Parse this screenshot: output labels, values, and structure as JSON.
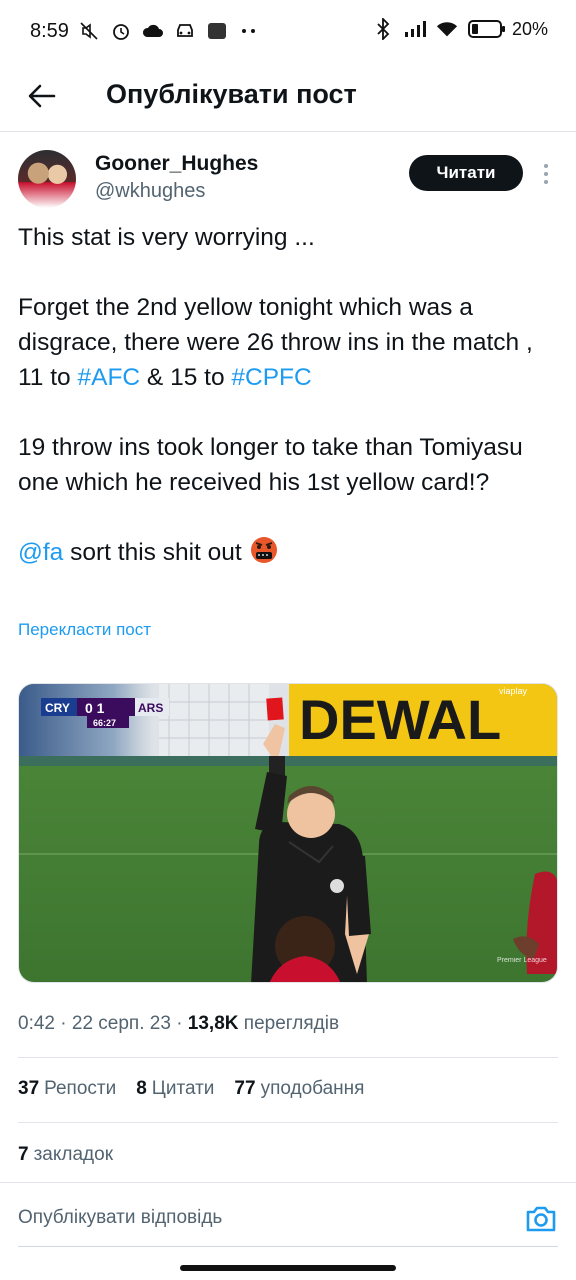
{
  "status_bar": {
    "time": "8:59",
    "battery": "20%",
    "icons": [
      "mute-icon",
      "alarm-icon",
      "cloud-icon",
      "car-icon",
      "app-icon",
      "more-dots-icon",
      "bluetooth-icon",
      "signal-icon",
      "wifi-icon",
      "battery-icon"
    ]
  },
  "header": {
    "title": "Опублікувати пост"
  },
  "author": {
    "name": "Gooner_Hughes",
    "handle": "@wkhughes",
    "follow_label": "Читати"
  },
  "tweet": {
    "line1": "This stat is very worrying ...",
    "para2_a": "Forget the 2nd yellow tonight which was a disgrace, there were 26 throw ins in the match , 11 to ",
    "hashtag_afc": "#AFC",
    "para2_mid": " & 15 to ",
    "hashtag_cpfc": "#CPFC",
    "para3": "19 throw ins took longer to take than Tomiyasu one which he received his 1st yellow card!?",
    "mention": "@fa",
    "para4_rest": " sort this shit out",
    "translate_label": "Перекласти пост"
  },
  "media": {
    "scoreboard_home": "CRY",
    "scoreboard_score": "0 1",
    "scoreboard_away": "ARS",
    "scoreboard_clock": "66:27",
    "banner_text": "DEWAL",
    "watermark": "viaplay",
    "league_tag": "Premier League"
  },
  "meta": {
    "time": "0:42",
    "date": "22 серп. 23",
    "views_count": "13,8K",
    "views_label": "переглядів"
  },
  "stats": {
    "reposts_count": "37",
    "reposts_label": "Репости",
    "quotes_count": "8",
    "quotes_label": "Цитати",
    "likes_count": "77",
    "likes_label": "уподобання",
    "bookmarks_count": "7",
    "bookmarks_label": "закладок"
  },
  "reply": {
    "placeholder": "Опублікувати відповідь"
  },
  "colors": {
    "accent": "#1d9bf0",
    "text": "#0f1419",
    "secondary": "#536471",
    "follow_bg": "#0f1419"
  }
}
